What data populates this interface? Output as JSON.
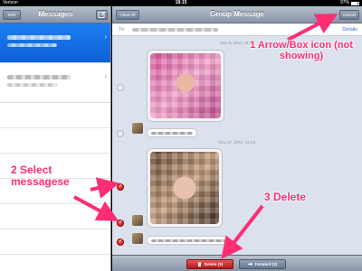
{
  "status_bar": {
    "carrier": "Verizon",
    "time": "18:15",
    "battery": "97%"
  },
  "left_panel": {
    "title": "Messages",
    "edit_label": "Edit"
  },
  "right_panel": {
    "title": "Group Message",
    "clear_all_label": "Clear All",
    "cancel_label": "Cancel",
    "to_label": "To:",
    "details_label": "Details",
    "timestamps": [
      "Nov 6, 2012, 11:11",
      "Nov 17, 2012, 11:14"
    ],
    "delete_label": "Delete (3)",
    "forward_label": "Forward (3)"
  },
  "annotations": {
    "step1": "1 Arrow/Box icon (not showing)",
    "step2": "2 Select messagese",
    "step3": "3 Delete"
  },
  "colors": {
    "annotation": "#ff2d72",
    "selection": "#1d7ff0",
    "delete": "#c62222"
  }
}
